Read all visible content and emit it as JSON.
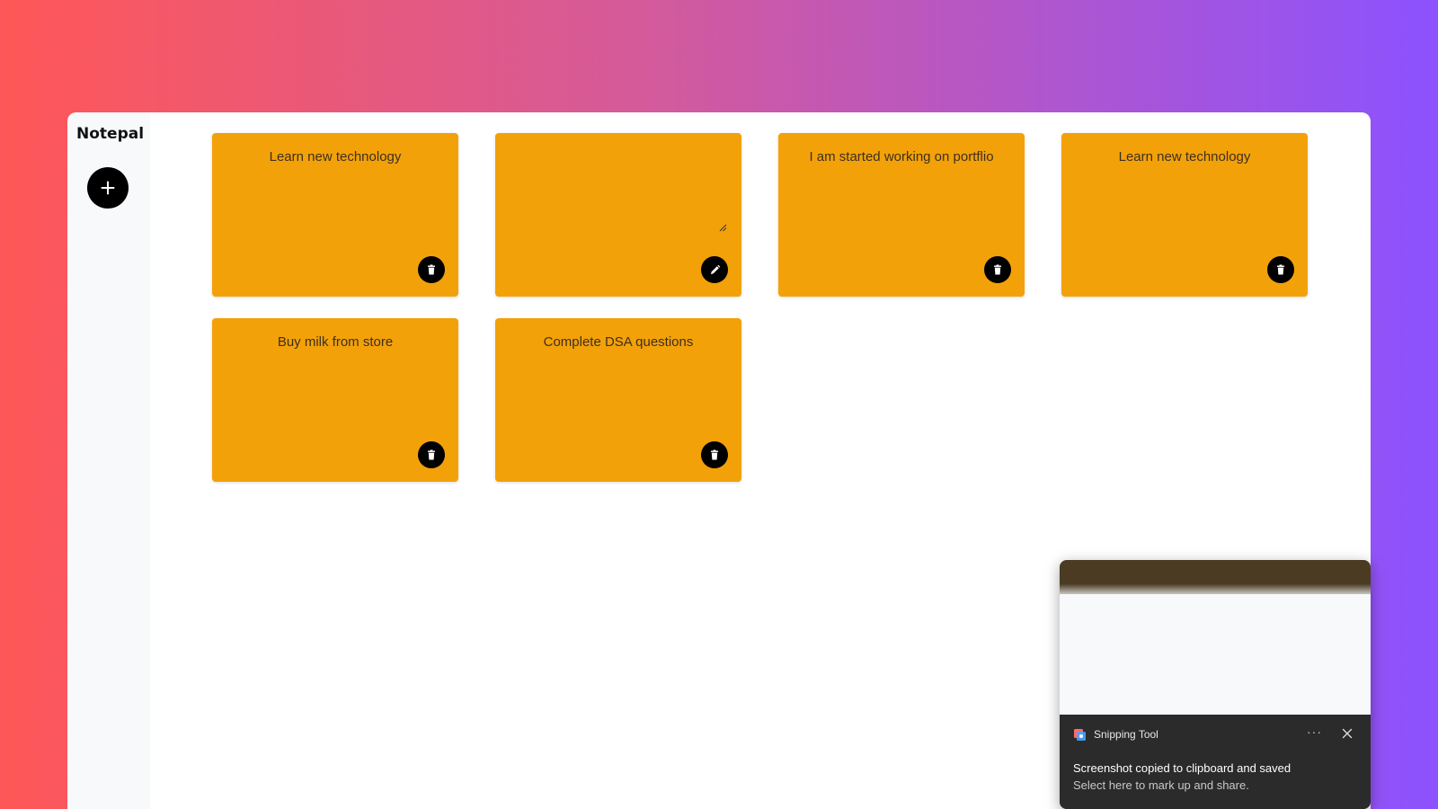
{
  "app": {
    "brand": "Notepal",
    "add_button_icon": "plus-icon",
    "note_color": "#f3a109"
  },
  "notes": [
    {
      "text": "Learn new technology",
      "action_icon": "trash-icon"
    },
    {
      "text": "",
      "action_icon": "pencil-icon",
      "editing": true
    },
    {
      "text": "I am started working on portflio",
      "action_icon": "trash-icon"
    },
    {
      "text": "Learn new technology",
      "action_icon": "trash-icon"
    },
    {
      "text": "Buy milk from store",
      "action_icon": "trash-icon"
    },
    {
      "text": "Complete DSA questions",
      "action_icon": "trash-icon"
    }
  ],
  "toast": {
    "app_name": "Snipping Tool",
    "more_label": "···",
    "title": "Screenshot copied to clipboard and saved",
    "subtitle": "Select here to mark up and share."
  }
}
